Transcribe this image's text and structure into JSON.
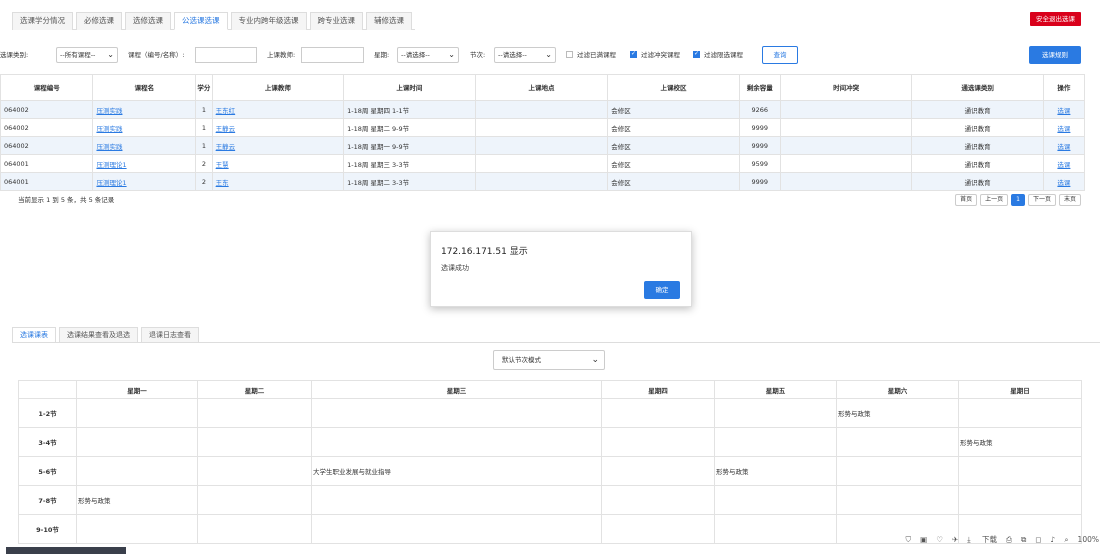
{
  "top_tabs": [
    "选课学分情况",
    "必修选课",
    "选修选课",
    "公选课选课",
    "专业内跨年级选课",
    "跨专业选课",
    "辅修选课"
  ],
  "logout_label": "安全退出选课",
  "filter": {
    "category_label": "选课类别:",
    "category_value": "--所有课程--",
    "course_label": "课程（编号/名称）:",
    "course_value": "",
    "teacher_label": "上课教师:",
    "teacher_value": "",
    "weekday_label": "星期:",
    "weekday_value": "--请选择--",
    "period_label": "节次:",
    "period_value": "--请选择--",
    "opt_full": "过滤已满课程",
    "opt_conflict": "过滤冲突课程",
    "opt_limit": "过滤限选课程",
    "query_label": "查询",
    "rules_label": "选课规则"
  },
  "table": {
    "headers": [
      "课程编号",
      "课程名",
      "学分",
      "上课教师",
      "上课时间",
      "上课地点",
      "上课校区",
      "剩余容量",
      "时间冲突",
      "通选课类别",
      "操作"
    ],
    "rows": [
      {
        "code": "064002",
        "name": "压测实践",
        "credit": "1",
        "teacher": "王东红",
        "time": "1-18周 星期四 1-1节",
        "place": "",
        "campus": "会修区",
        "remain": "9266",
        "conflict": "",
        "category": "通识教育",
        "action": "选课"
      },
      {
        "code": "064002",
        "name": "压测实践",
        "credit": "1",
        "teacher": "王静云",
        "time": "1-18周 星期二 9-9节",
        "place": "",
        "campus": "会修区",
        "remain": "9999",
        "conflict": "",
        "category": "通识教育",
        "action": "选课"
      },
      {
        "code": "064002",
        "name": "压测实践",
        "credit": "1",
        "teacher": "王静云",
        "time": "1-18周 星期一 9-9节",
        "place": "",
        "campus": "会修区",
        "remain": "9999",
        "conflict": "",
        "category": "通识教育",
        "action": "选课"
      },
      {
        "code": "064001",
        "name": "压测理论1",
        "credit": "2",
        "teacher": "王慧",
        "time": "1-18周 星期三 3-3节",
        "place": "",
        "campus": "会修区",
        "remain": "9599",
        "conflict": "",
        "category": "通识教育",
        "action": "选课"
      },
      {
        "code": "064001",
        "name": "压测理论1",
        "credit": "2",
        "teacher": "王东",
        "time": "1-18周 星期二 3-3节",
        "place": "",
        "campus": "会修区",
        "remain": "9999",
        "conflict": "",
        "category": "通识教育",
        "action": "选课"
      }
    ]
  },
  "pager": {
    "info": "当前显示 1 到 5 条，共 5 条记录",
    "first": "首页",
    "prev": "上一页",
    "current": "1",
    "next": "下一页",
    "last": "末页"
  },
  "dialog": {
    "title": "172.16.171.51 显示",
    "message": "选课成功",
    "ok": "确定"
  },
  "bottom_tabs": [
    "选课课表",
    "选课结果查看及退选",
    "退课日志查看"
  ],
  "schedule": {
    "mode": "默认节次模式",
    "days": [
      "星期一",
      "星期二",
      "星期三",
      "星期四",
      "星期五",
      "星期六",
      "星期日"
    ],
    "slots": [
      "1-2节",
      "3-4节",
      "5-6节",
      "7-8节",
      "9-10节"
    ],
    "cells": [
      [
        "",
        "",
        "",
        "",
        "",
        "形势与政策",
        ""
      ],
      [
        "",
        "",
        "",
        "",
        "",
        "",
        "形势与政策"
      ],
      [
        "",
        "",
        "大学生职业发展与就业指导",
        "",
        "形势与政策",
        "",
        ""
      ],
      [
        "形势与政策",
        "",
        "",
        "",
        "",
        "",
        ""
      ],
      [
        "",
        "",
        "",
        "",
        "",
        "",
        ""
      ]
    ]
  },
  "status_bar": {
    "download": "下载",
    "zoom": "100%"
  },
  "colors": {
    "accent": "#2a7ae2",
    "danger": "#d9001b",
    "row_stripe": "#eef4fb"
  }
}
